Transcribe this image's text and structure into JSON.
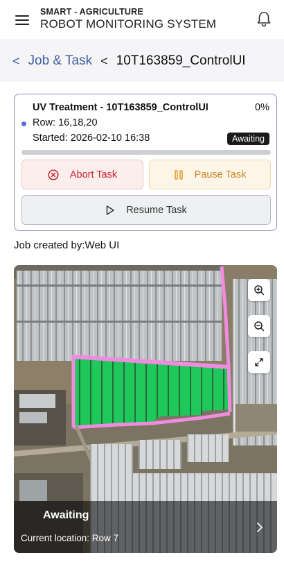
{
  "header": {
    "title_line1": "SMART - AGRICULTURE",
    "title_line2": "ROBOT MONITORING SYSTEM",
    "menu_icon": "hamburger-menu-icon",
    "notification_icon": "bell-icon"
  },
  "breadcrumb": {
    "parent": "Job & Task",
    "current": "10T163859_ControlUI"
  },
  "task": {
    "title": "UV Treatment - 10T163859_ControlUI",
    "progress_text": "0%",
    "progress_fraction": 0,
    "row": "Row: 16,18,20",
    "started": "Started: 2026-02-10 16:38",
    "status_badge": "Awaiting",
    "abort_label": "Abort Task",
    "pause_label": "Pause Task",
    "resume_label": "Resume Task"
  },
  "job_created_by": "Job created by:Web UI",
  "map": {
    "zoom_in_icon": "zoom-in-icon",
    "zoom_out_icon": "zoom-out-icon",
    "fullscreen_icon": "expand-icon",
    "status_title": "Awaiting",
    "current_location": "Current location: Row 7"
  },
  "colors": {
    "accent": "#3f5fa0",
    "card_border": "#8a86c9",
    "abort": "#c4282e",
    "pause": "#c9862a",
    "route": "#f08ce0",
    "rows_fill": "#1fc85a"
  }
}
